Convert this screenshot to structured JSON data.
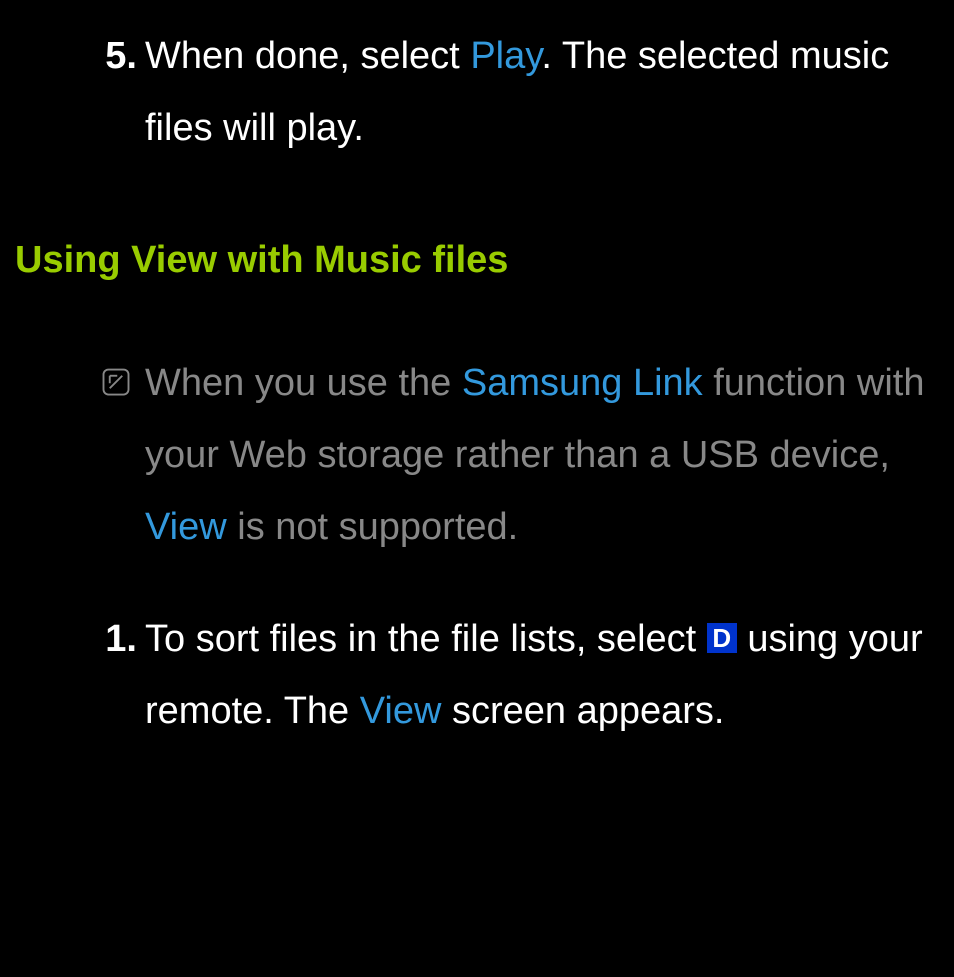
{
  "item5": {
    "number": "5.",
    "text_before": "When done, select ",
    "highlight": "Play",
    "text_after": ". The selected music files will play."
  },
  "heading": "Using View with Music files",
  "note": {
    "text_before": "When you use the ",
    "highlight1": "Samsung Link",
    "text_mid": " function with your Web storage rather than a USB device, ",
    "highlight2": "View",
    "text_after": " is not supported."
  },
  "step1": {
    "number": "1.",
    "text_before": "To sort files in the file lists, select ",
    "button": "D",
    "text_mid": " using your remote. The ",
    "highlight": "View",
    "text_after": " screen appears."
  }
}
